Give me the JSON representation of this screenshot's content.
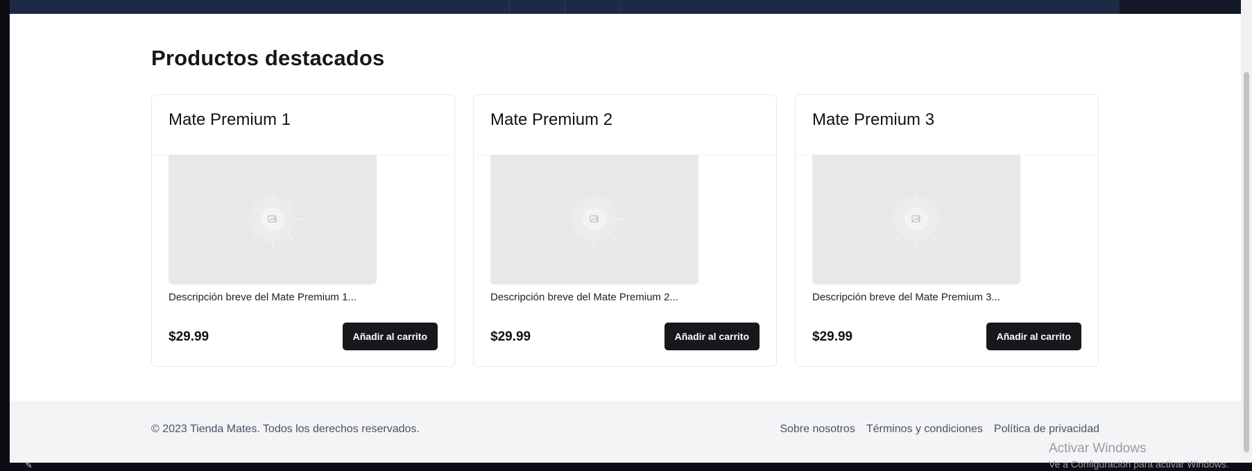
{
  "section": {
    "title": "Productos destacados"
  },
  "products": [
    {
      "title": "Mate Premium 1",
      "description": "Descripción breve del Mate Premium 1...",
      "price": "$29.99",
      "button_label": "Añadir al carrito"
    },
    {
      "title": "Mate Premium 2",
      "description": "Descripción breve del Mate Premium 2...",
      "price": "$29.99",
      "button_label": "Añadir al carrito"
    },
    {
      "title": "Mate Premium 3",
      "description": "Descripción breve del Mate Premium 3...",
      "price": "$29.99",
      "button_label": "Añadir al carrito"
    }
  ],
  "footer": {
    "copyright": "© 2023 Tienda Mates. Todos los derechos reservados.",
    "links": [
      "Sobre nosotros",
      "Términos y condiciones",
      "Política de privacidad"
    ]
  },
  "watermark": {
    "title": "Activar Windows",
    "subtitle": "Ve a Configuración para activar Windows."
  },
  "icons": {
    "product_image": "image-placeholder-icon",
    "taskbar": "pen-icon"
  },
  "colors": {
    "hero_band": "#1d2a45",
    "button_bg": "#17181b",
    "footer_bg": "#f3f4f6"
  }
}
